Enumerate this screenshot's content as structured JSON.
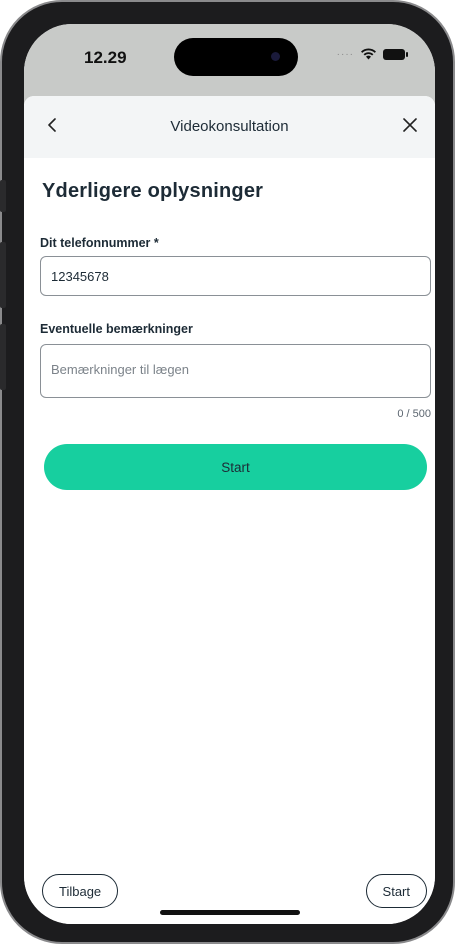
{
  "status_bar": {
    "time": "12.29",
    "signal_icon": "signal-dots-icon",
    "wifi_icon": "wifi-icon",
    "battery_icon": "battery-icon"
  },
  "nav": {
    "back_icon": "chevron-left-icon",
    "title": "Videokonsultation",
    "close_icon": "close-icon"
  },
  "form": {
    "heading": "Yderligere oplysninger",
    "phone_label": "Dit telefonnummer *",
    "phone_value": "12345678",
    "remarks_label": "Eventuelle bemærkninger",
    "remarks_placeholder": "Bemærkninger til lægen",
    "char_count": "0 / 500",
    "start_button": "Start"
  },
  "footer": {
    "back_button": "Tilbage",
    "start_button": "Start"
  },
  "colors": {
    "accent": "#17cf9f",
    "text": "#1d2b36",
    "nav_background": "#f3f5f6",
    "status_background": "#c8cac8"
  }
}
